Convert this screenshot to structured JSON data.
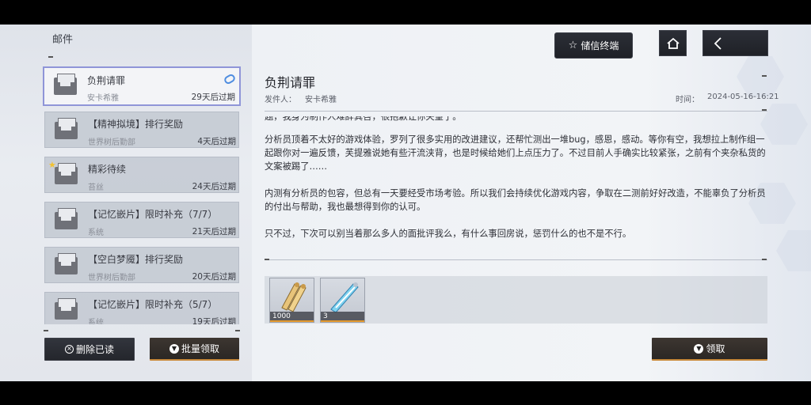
{
  "page_title": "邮件",
  "top_bar": {
    "storage_button": "储信终端",
    "home_icon": "home-icon",
    "back_icon": "back-arrow-icon"
  },
  "mail_list": [
    {
      "title": "负荆请罪",
      "sender": "安卡希雅",
      "expire": "29天后过期",
      "selected": true,
      "attachment": true
    },
    {
      "title": "【精神拟境】排行奖励",
      "sender": "世界树后勤部",
      "expire": "4天后过期"
    },
    {
      "title": "精彩待续",
      "sender": "苔丝",
      "expire": "24天后过期",
      "starred": true
    },
    {
      "title": "【记忆嵌片】限时补充（7/7）",
      "sender": "系统",
      "expire": "21天后过期"
    },
    {
      "title": "【空白梦魇】排行奖励",
      "sender": "世界树后勤部",
      "expire": "20天后过期"
    },
    {
      "title": "【记忆嵌片】限时补充（5/7）",
      "sender": "系统",
      "expire": "19天后过期"
    }
  ],
  "list_buttons": {
    "delete_read": "删除已读",
    "claim_all": "批量领取"
  },
  "detail": {
    "title": "负荆请罪",
    "sender_label": "发件人：",
    "sender": "安卡希雅",
    "time_label": "时间：",
    "time": "2024-05-16-16:21",
    "cutoff_line": "题，我身为制作人难辞其咎，很抱歉让你失望了。",
    "paragraphs": [
      "分析员顶着不太好的游戏体验，罗列了很多实用的改进建议，还帮忙测出一堆bug，感恩，感动。等你有空，我想拉上制作组一起跟你对一遍反馈，芙提雅说她有些汗流浃背，也是时候给她们上点压力了。不过目前人手确实比较紧张，之前有个夹杂私货的文案被踢了……",
      "内测有分析员的包容，但总有一天要经受市场考验。所以我们会持续优化游戏内容，争取在二测前好好改造，不能辜负了分析员的付出与帮助，我也最想得到你的认可。",
      "只不过，下次可以别当着那么多人的面批评我么，有什么事回房说，惩罚什么的也不是不行。"
    ],
    "attachments": [
      {
        "icon": "scroll-bundle-icon",
        "qty": "1000"
      },
      {
        "icon": "blue-crystal-stick-icon",
        "qty": "3"
      }
    ],
    "claim_button": "领取"
  },
  "colors": {
    "selected_border": "#8f95d8",
    "accent_orange": "#e59a2e",
    "clip_blue": "#4f8de0",
    "star_yellow": "#f2c230"
  }
}
